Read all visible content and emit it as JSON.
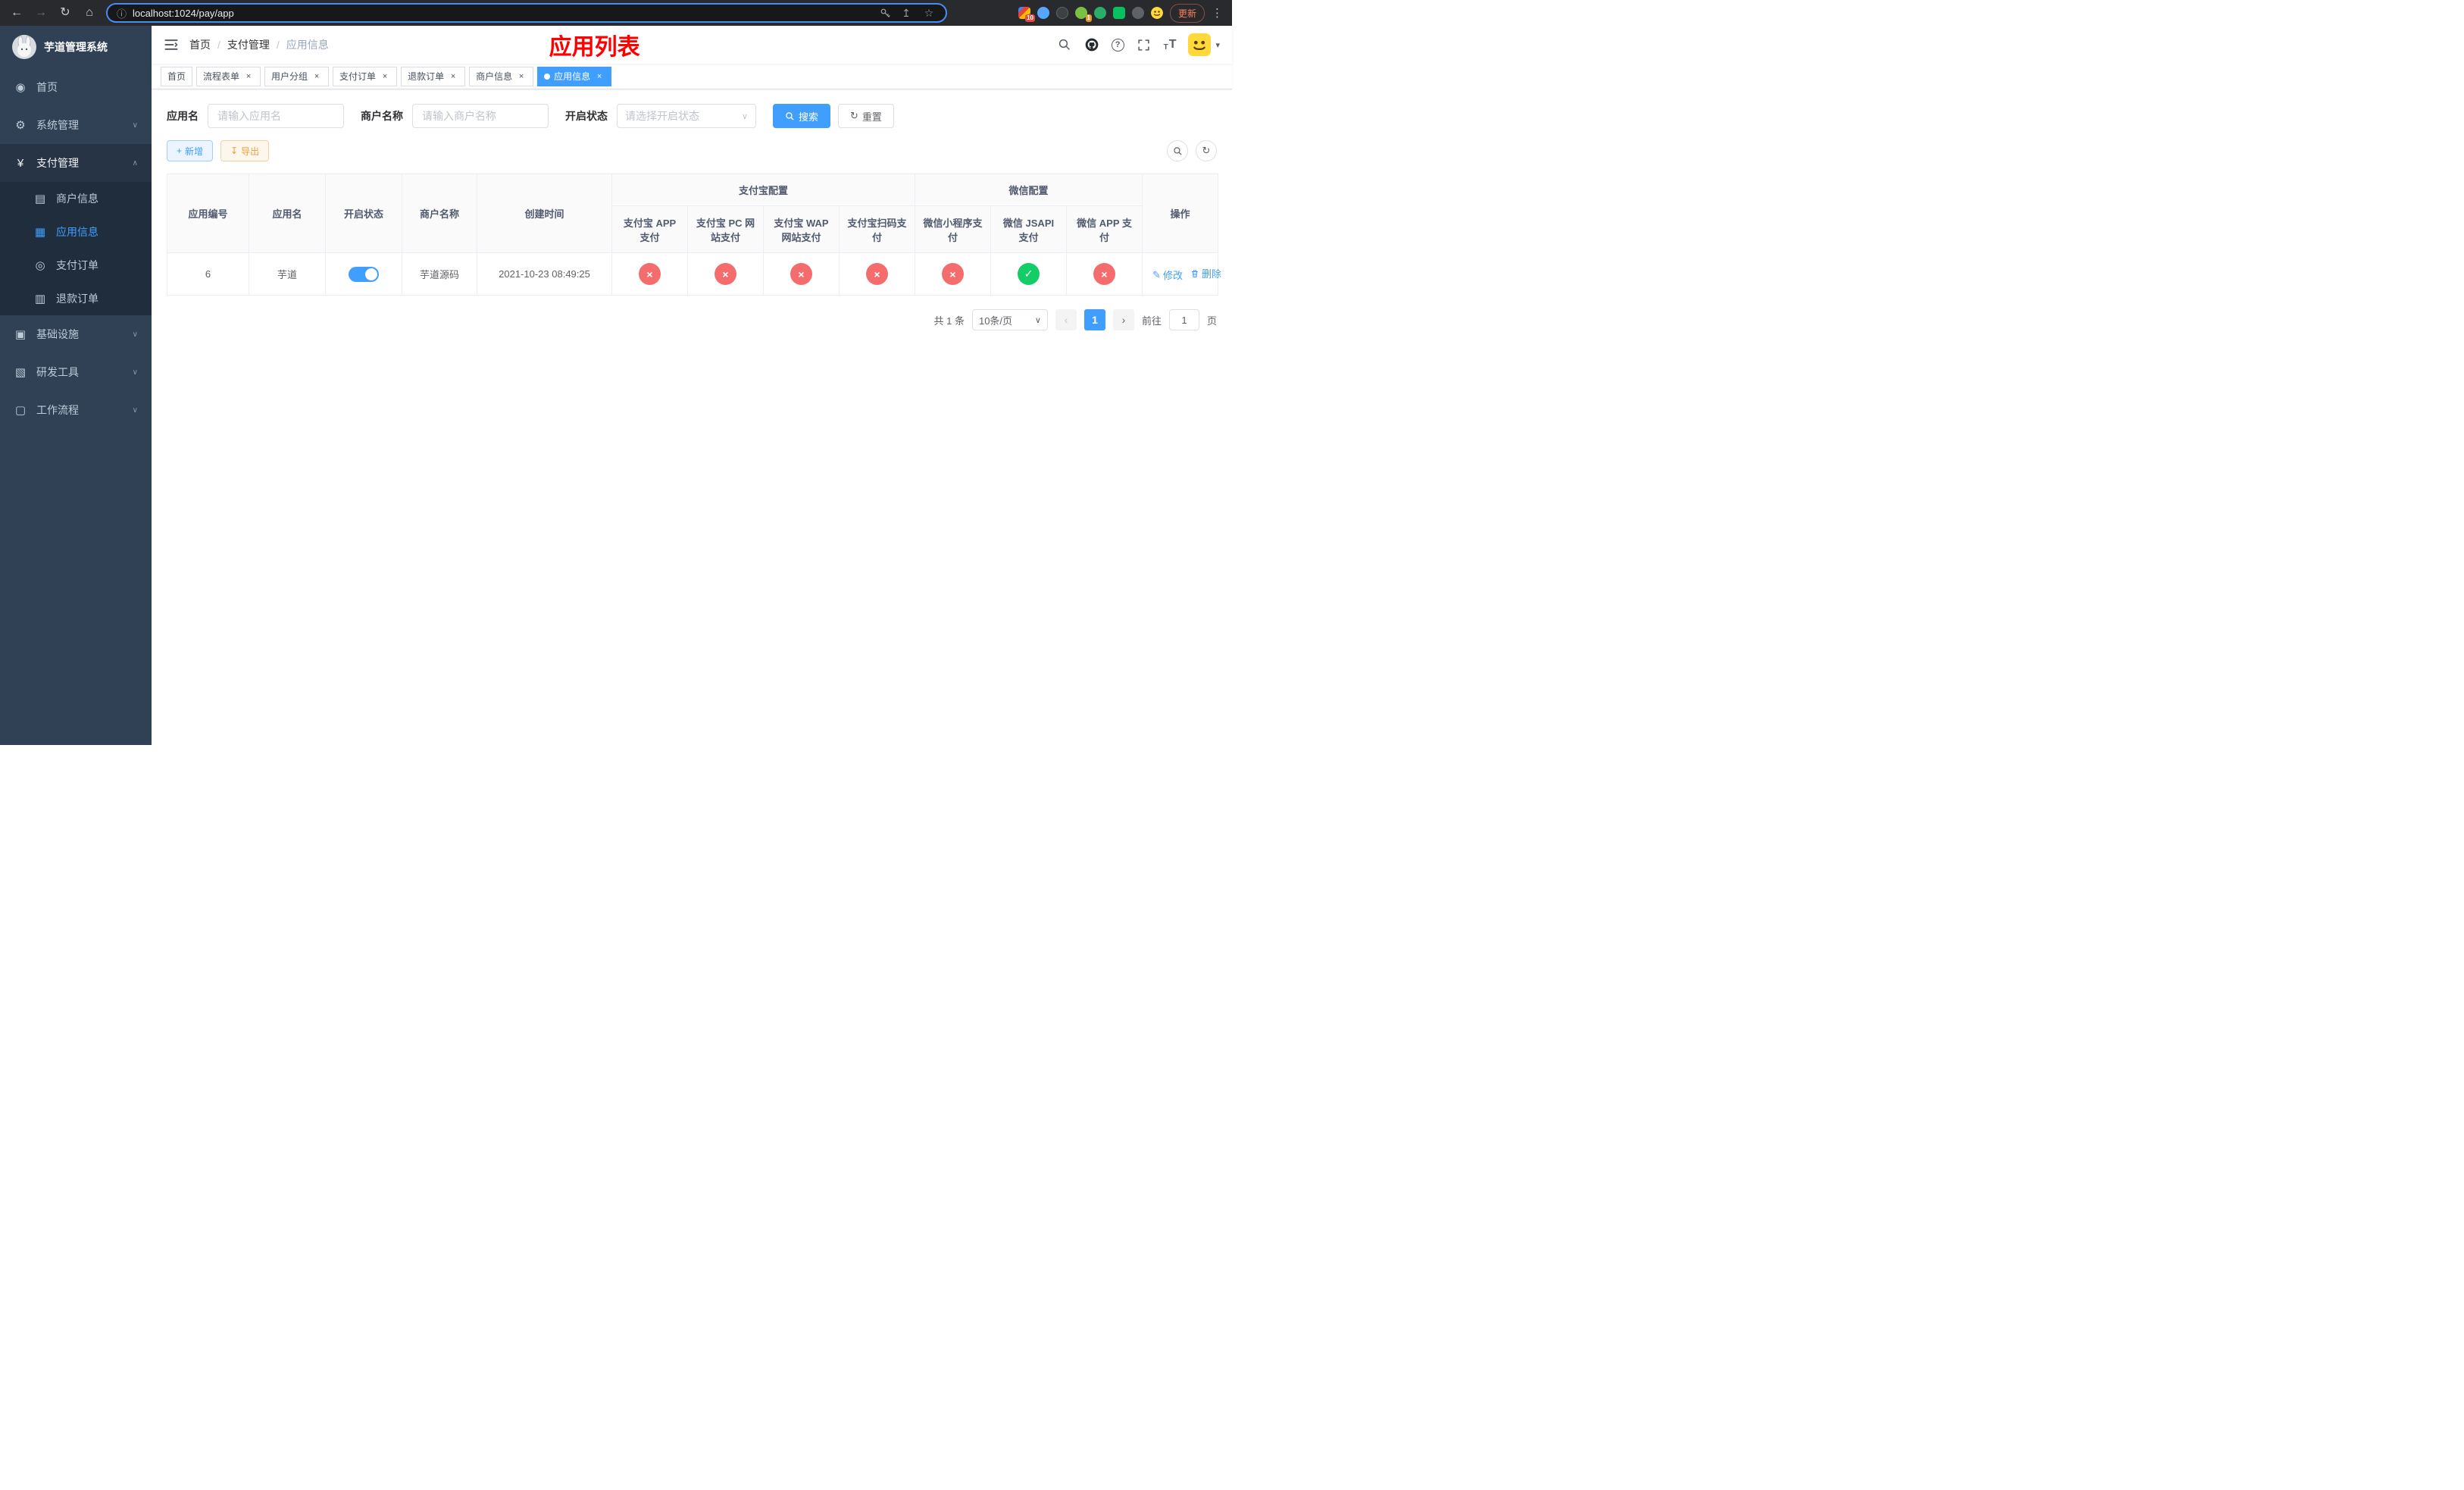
{
  "colors": {
    "primary": "#409eff",
    "success": "#13ce66",
    "danger": "#f56c6c",
    "warning": "#e6a23c",
    "banner": "#ff0000",
    "sidebar": "#304156"
  },
  "browser": {
    "url": "localhost:1024/pay/app",
    "update_button": "更新",
    "extension_badge_1": "10",
    "extension_badge_2": "1"
  },
  "sidebar": {
    "app_title": "芋道管理系统",
    "home": "首页",
    "system": "系统管理",
    "payment": "支付管理",
    "merchant_info": "商户信息",
    "app_info": "应用信息",
    "pay_order": "支付订单",
    "refund_order": "退款订单",
    "infrastructure": "基础设施",
    "dev_tools": "研发工具",
    "workflow": "工作流程"
  },
  "navbar": {
    "breadcrumb": [
      "首页",
      "支付管理",
      "应用信息"
    ],
    "banner": "应用列表"
  },
  "tabs": [
    {
      "label": "首页"
    },
    {
      "label": "流程表单"
    },
    {
      "label": "用户分组"
    },
    {
      "label": "支付订单"
    },
    {
      "label": "退款订单"
    },
    {
      "label": "商户信息"
    },
    {
      "label": "应用信息"
    }
  ],
  "filters": {
    "app_name_label": "应用名",
    "app_name_placeholder": "请输入应用名",
    "merchant_label": "商户名称",
    "merchant_placeholder": "请输入商户名称",
    "status_label": "开启状态",
    "status_placeholder": "请选择开启状态",
    "search": "搜索",
    "reset": "重置"
  },
  "toolbar": {
    "add": "新增",
    "export": "导出"
  },
  "table": {
    "headers": {
      "app_id": "应用编号",
      "app_name": "应用名",
      "status": "开启状态",
      "merchant": "商户名称",
      "created": "创建时间",
      "alipay_group": "支付宝配置",
      "wechat_group": "微信配置",
      "alipay_app": "支付宝 APP 支付",
      "alipay_pc": "支付宝 PC 网站支付",
      "alipay_wap": "支付宝 WAP 网站支付",
      "alipay_qr": "支付宝扫码支付",
      "wx_mini": "微信小程序支付",
      "wx_jsapi": "微信 JSAPI 支付",
      "wx_app": "微信 APP 支付",
      "actions": "操作"
    },
    "rows": [
      {
        "app_id": "6",
        "app_name": "芋道",
        "status_on": true,
        "merchant": "芋道源码",
        "created": "2021-10-23 08:49:25",
        "configs": [
          "no",
          "no",
          "no",
          "no",
          "no",
          "yes",
          "no"
        ],
        "edit": "修改",
        "delete": "删除"
      }
    ]
  },
  "pagination": {
    "total": "共 1 条",
    "page_size": "10条/页",
    "page": "1",
    "goto": "前往",
    "goto_value": "1",
    "unit": "页"
  },
  "icons": {
    "back": "←",
    "forward": "→",
    "reload": "↻",
    "home": "⌂",
    "info": "ⓘ",
    "share": "↥",
    "star": "☆",
    "dots": "⋮",
    "dashboard": "◉",
    "gear": "⚙",
    "yen": "¥",
    "card": "▤",
    "grid": "▦",
    "order": "◎",
    "refund": "▥",
    "infra": "▣",
    "tools": "▧",
    "flow": "▢",
    "chevron_down": "∨",
    "chevron_up": "∧",
    "plus": "+",
    "download": "↧",
    "refresh": "↻",
    "close": "×",
    "edit": "✎",
    "caret_down": "▾",
    "question": "?",
    "text": "T",
    "prev": "‹",
    "next": "›"
  }
}
